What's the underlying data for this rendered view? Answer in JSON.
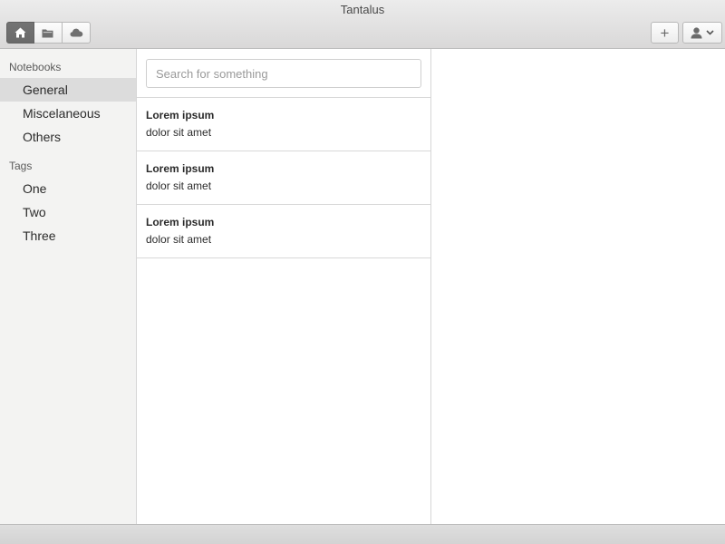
{
  "window": {
    "title": "Tantalus"
  },
  "toolbar": {
    "buttons": [
      {
        "icon": "home-icon",
        "active": true
      },
      {
        "icon": "folder-icon",
        "active": false
      },
      {
        "icon": "cloud-icon",
        "active": false
      }
    ],
    "add_label": "+",
    "user_icon": "user-icon",
    "user_menu_icon": "chevron-down-icon"
  },
  "sidebar": {
    "notebooks_heading": "Notebooks",
    "notebooks": [
      {
        "label": "General",
        "selected": true
      },
      {
        "label": "Miscelaneous",
        "selected": false
      },
      {
        "label": "Others",
        "selected": false
      }
    ],
    "tags_heading": "Tags",
    "tags": [
      {
        "label": "One"
      },
      {
        "label": "Two"
      },
      {
        "label": "Three"
      }
    ]
  },
  "search": {
    "placeholder": "Search for something",
    "value": ""
  },
  "notes": [
    {
      "title": "Lorem ipsum",
      "body": "dolor sit amet"
    },
    {
      "title": "Lorem ipsum",
      "body": "dolor sit amet"
    },
    {
      "title": "Lorem ipsum",
      "body": "dolor sit amet"
    }
  ],
  "colors": {
    "active_button": "#6f6f6f",
    "selected_item": "#dcdcdc",
    "sidebar_bg": "#f3f3f2",
    "toolbar_bg": "#d9d8d8"
  }
}
